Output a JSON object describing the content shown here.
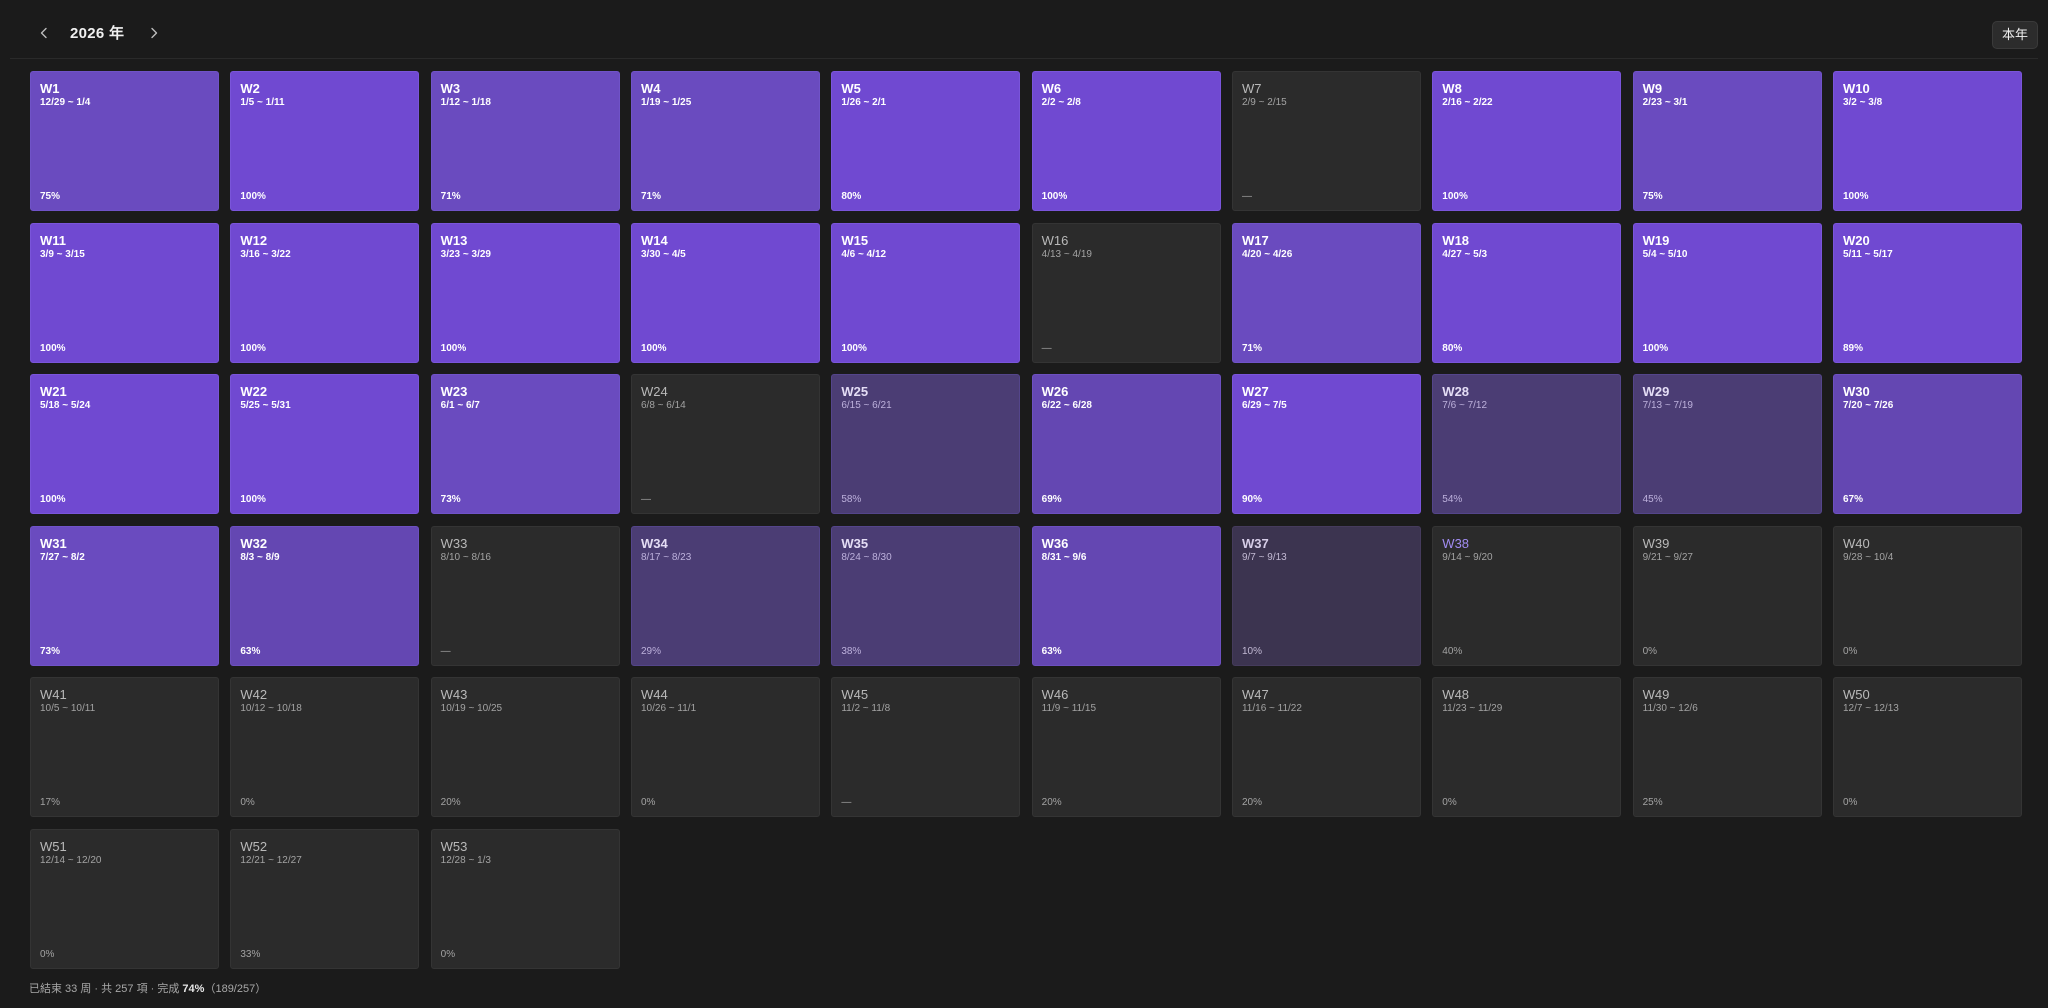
{
  "header": {
    "year_title": "2026 年",
    "this_year_label": "本年"
  },
  "weeks": [
    {
      "label": "W1",
      "range": "12/29 ~ 1/4",
      "pct": "75%",
      "tier": 4
    },
    {
      "label": "W2",
      "range": "1/5 ~ 1/11",
      "pct": "100%",
      "tier": 5
    },
    {
      "label": "W3",
      "range": "1/12 ~ 1/18",
      "pct": "71%",
      "tier": 4
    },
    {
      "label": "W4",
      "range": "1/19 ~ 1/25",
      "pct": "71%",
      "tier": 4
    },
    {
      "label": "W5",
      "range": "1/26 ~ 2/1",
      "pct": "80%",
      "tier": 5
    },
    {
      "label": "W6",
      "range": "2/2 ~ 2/8",
      "pct": "100%",
      "tier": 5
    },
    {
      "label": "W7",
      "range": "2/9 ~ 2/15",
      "pct": "—",
      "tier": 0
    },
    {
      "label": "W8",
      "range": "2/16 ~ 2/22",
      "pct": "100%",
      "tier": 5
    },
    {
      "label": "W9",
      "range": "2/23 ~ 3/1",
      "pct": "75%",
      "tier": 4
    },
    {
      "label": "W10",
      "range": "3/2 ~ 3/8",
      "pct": "100%",
      "tier": 5
    },
    {
      "label": "W11",
      "range": "3/9 ~ 3/15",
      "pct": "100%",
      "tier": 5
    },
    {
      "label": "W12",
      "range": "3/16 ~ 3/22",
      "pct": "100%",
      "tier": 5
    },
    {
      "label": "W13",
      "range": "3/23 ~ 3/29",
      "pct": "100%",
      "tier": 5
    },
    {
      "label": "W14",
      "range": "3/30 ~ 4/5",
      "pct": "100%",
      "tier": 5
    },
    {
      "label": "W15",
      "range": "4/6 ~ 4/12",
      "pct": "100%",
      "tier": 5
    },
    {
      "label": "W16",
      "range": "4/13 ~ 4/19",
      "pct": "—",
      "tier": 0
    },
    {
      "label": "W17",
      "range": "4/20 ~ 4/26",
      "pct": "71%",
      "tier": 4
    },
    {
      "label": "W18",
      "range": "4/27 ~ 5/3",
      "pct": "80%",
      "tier": 5
    },
    {
      "label": "W19",
      "range": "5/4 ~ 5/10",
      "pct": "100%",
      "tier": 5
    },
    {
      "label": "W20",
      "range": "5/11 ~ 5/17",
      "pct": "89%",
      "tier": 5
    },
    {
      "label": "W21",
      "range": "5/18 ~ 5/24",
      "pct": "100%",
      "tier": 5
    },
    {
      "label": "W22",
      "range": "5/25 ~ 5/31",
      "pct": "100%",
      "tier": 5
    },
    {
      "label": "W23",
      "range": "6/1 ~ 6/7",
      "pct": "73%",
      "tier": 4
    },
    {
      "label": "W24",
      "range": "6/8 ~ 6/14",
      "pct": "—",
      "tier": 0
    },
    {
      "label": "W25",
      "range": "6/15 ~ 6/21",
      "pct": "58%",
      "tier": 2
    },
    {
      "label": "W26",
      "range": "6/22 ~ 6/28",
      "pct": "69%",
      "tier": 3
    },
    {
      "label": "W27",
      "range": "6/29 ~ 7/5",
      "pct": "90%",
      "tier": 5
    },
    {
      "label": "W28",
      "range": "7/6 ~ 7/12",
      "pct": "54%",
      "tier": 2
    },
    {
      "label": "W29",
      "range": "7/13 ~ 7/19",
      "pct": "45%",
      "tier": 2
    },
    {
      "label": "W30",
      "range": "7/20 ~ 7/26",
      "pct": "67%",
      "tier": 3
    },
    {
      "label": "W31",
      "range": "7/27 ~ 8/2",
      "pct": "73%",
      "tier": 4
    },
    {
      "label": "W32",
      "range": "8/3 ~ 8/9",
      "pct": "63%",
      "tier": 3
    },
    {
      "label": "W33",
      "range": "8/10 ~ 8/16",
      "pct": "—",
      "tier": 0
    },
    {
      "label": "W34",
      "range": "8/17 ~ 8/23",
      "pct": "29%",
      "tier": 2
    },
    {
      "label": "W35",
      "range": "8/24 ~ 8/30",
      "pct": "38%",
      "tier": 2
    },
    {
      "label": "W36",
      "range": "8/31 ~ 9/6",
      "pct": "63%",
      "tier": 3
    },
    {
      "label": "W37",
      "range": "9/7 ~ 9/13",
      "pct": "10%",
      "tier": 1
    },
    {
      "label": "W38",
      "range": "9/14 ~ 9/20",
      "pct": "40%",
      "tier": 0,
      "current": true
    },
    {
      "label": "W39",
      "range": "9/21 ~ 9/27",
      "pct": "0%",
      "tier": 0
    },
    {
      "label": "W40",
      "range": "9/28 ~ 10/4",
      "pct": "0%",
      "tier": 0
    },
    {
      "label": "W41",
      "range": "10/5 ~ 10/11",
      "pct": "17%",
      "tier": 0
    },
    {
      "label": "W42",
      "range": "10/12 ~ 10/18",
      "pct": "0%",
      "tier": 0
    },
    {
      "label": "W43",
      "range": "10/19 ~ 10/25",
      "pct": "20%",
      "tier": 0
    },
    {
      "label": "W44",
      "range": "10/26 ~ 11/1",
      "pct": "0%",
      "tier": 0
    },
    {
      "label": "W45",
      "range": "11/2 ~ 11/8",
      "pct": "—",
      "tier": 0
    },
    {
      "label": "W46",
      "range": "11/9 ~ 11/15",
      "pct": "20%",
      "tier": 0
    },
    {
      "label": "W47",
      "range": "11/16 ~ 11/22",
      "pct": "20%",
      "tier": 0
    },
    {
      "label": "W48",
      "range": "11/23 ~ 11/29",
      "pct": "0%",
      "tier": 0
    },
    {
      "label": "W49",
      "range": "11/30 ~ 12/6",
      "pct": "25%",
      "tier": 0
    },
    {
      "label": "W50",
      "range": "12/7 ~ 12/13",
      "pct": "0%",
      "tier": 0
    },
    {
      "label": "W51",
      "range": "12/14 ~ 12/20",
      "pct": "0%",
      "tier": 0
    },
    {
      "label": "W52",
      "range": "12/21 ~ 12/27",
      "pct": "33%",
      "tier": 0
    },
    {
      "label": "W53",
      "range": "12/28 ~ 1/3",
      "pct": "0%",
      "tier": 0
    }
  ],
  "footer": {
    "prefix": "已結束 33 周 · 共 257 項 · 完成 ",
    "percent": "74%",
    "suffix": "（189/257）"
  },
  "colors": {
    "background": "#1b1b1b",
    "accent": "#7049d1",
    "current_week_text": "#a18cf2"
  }
}
